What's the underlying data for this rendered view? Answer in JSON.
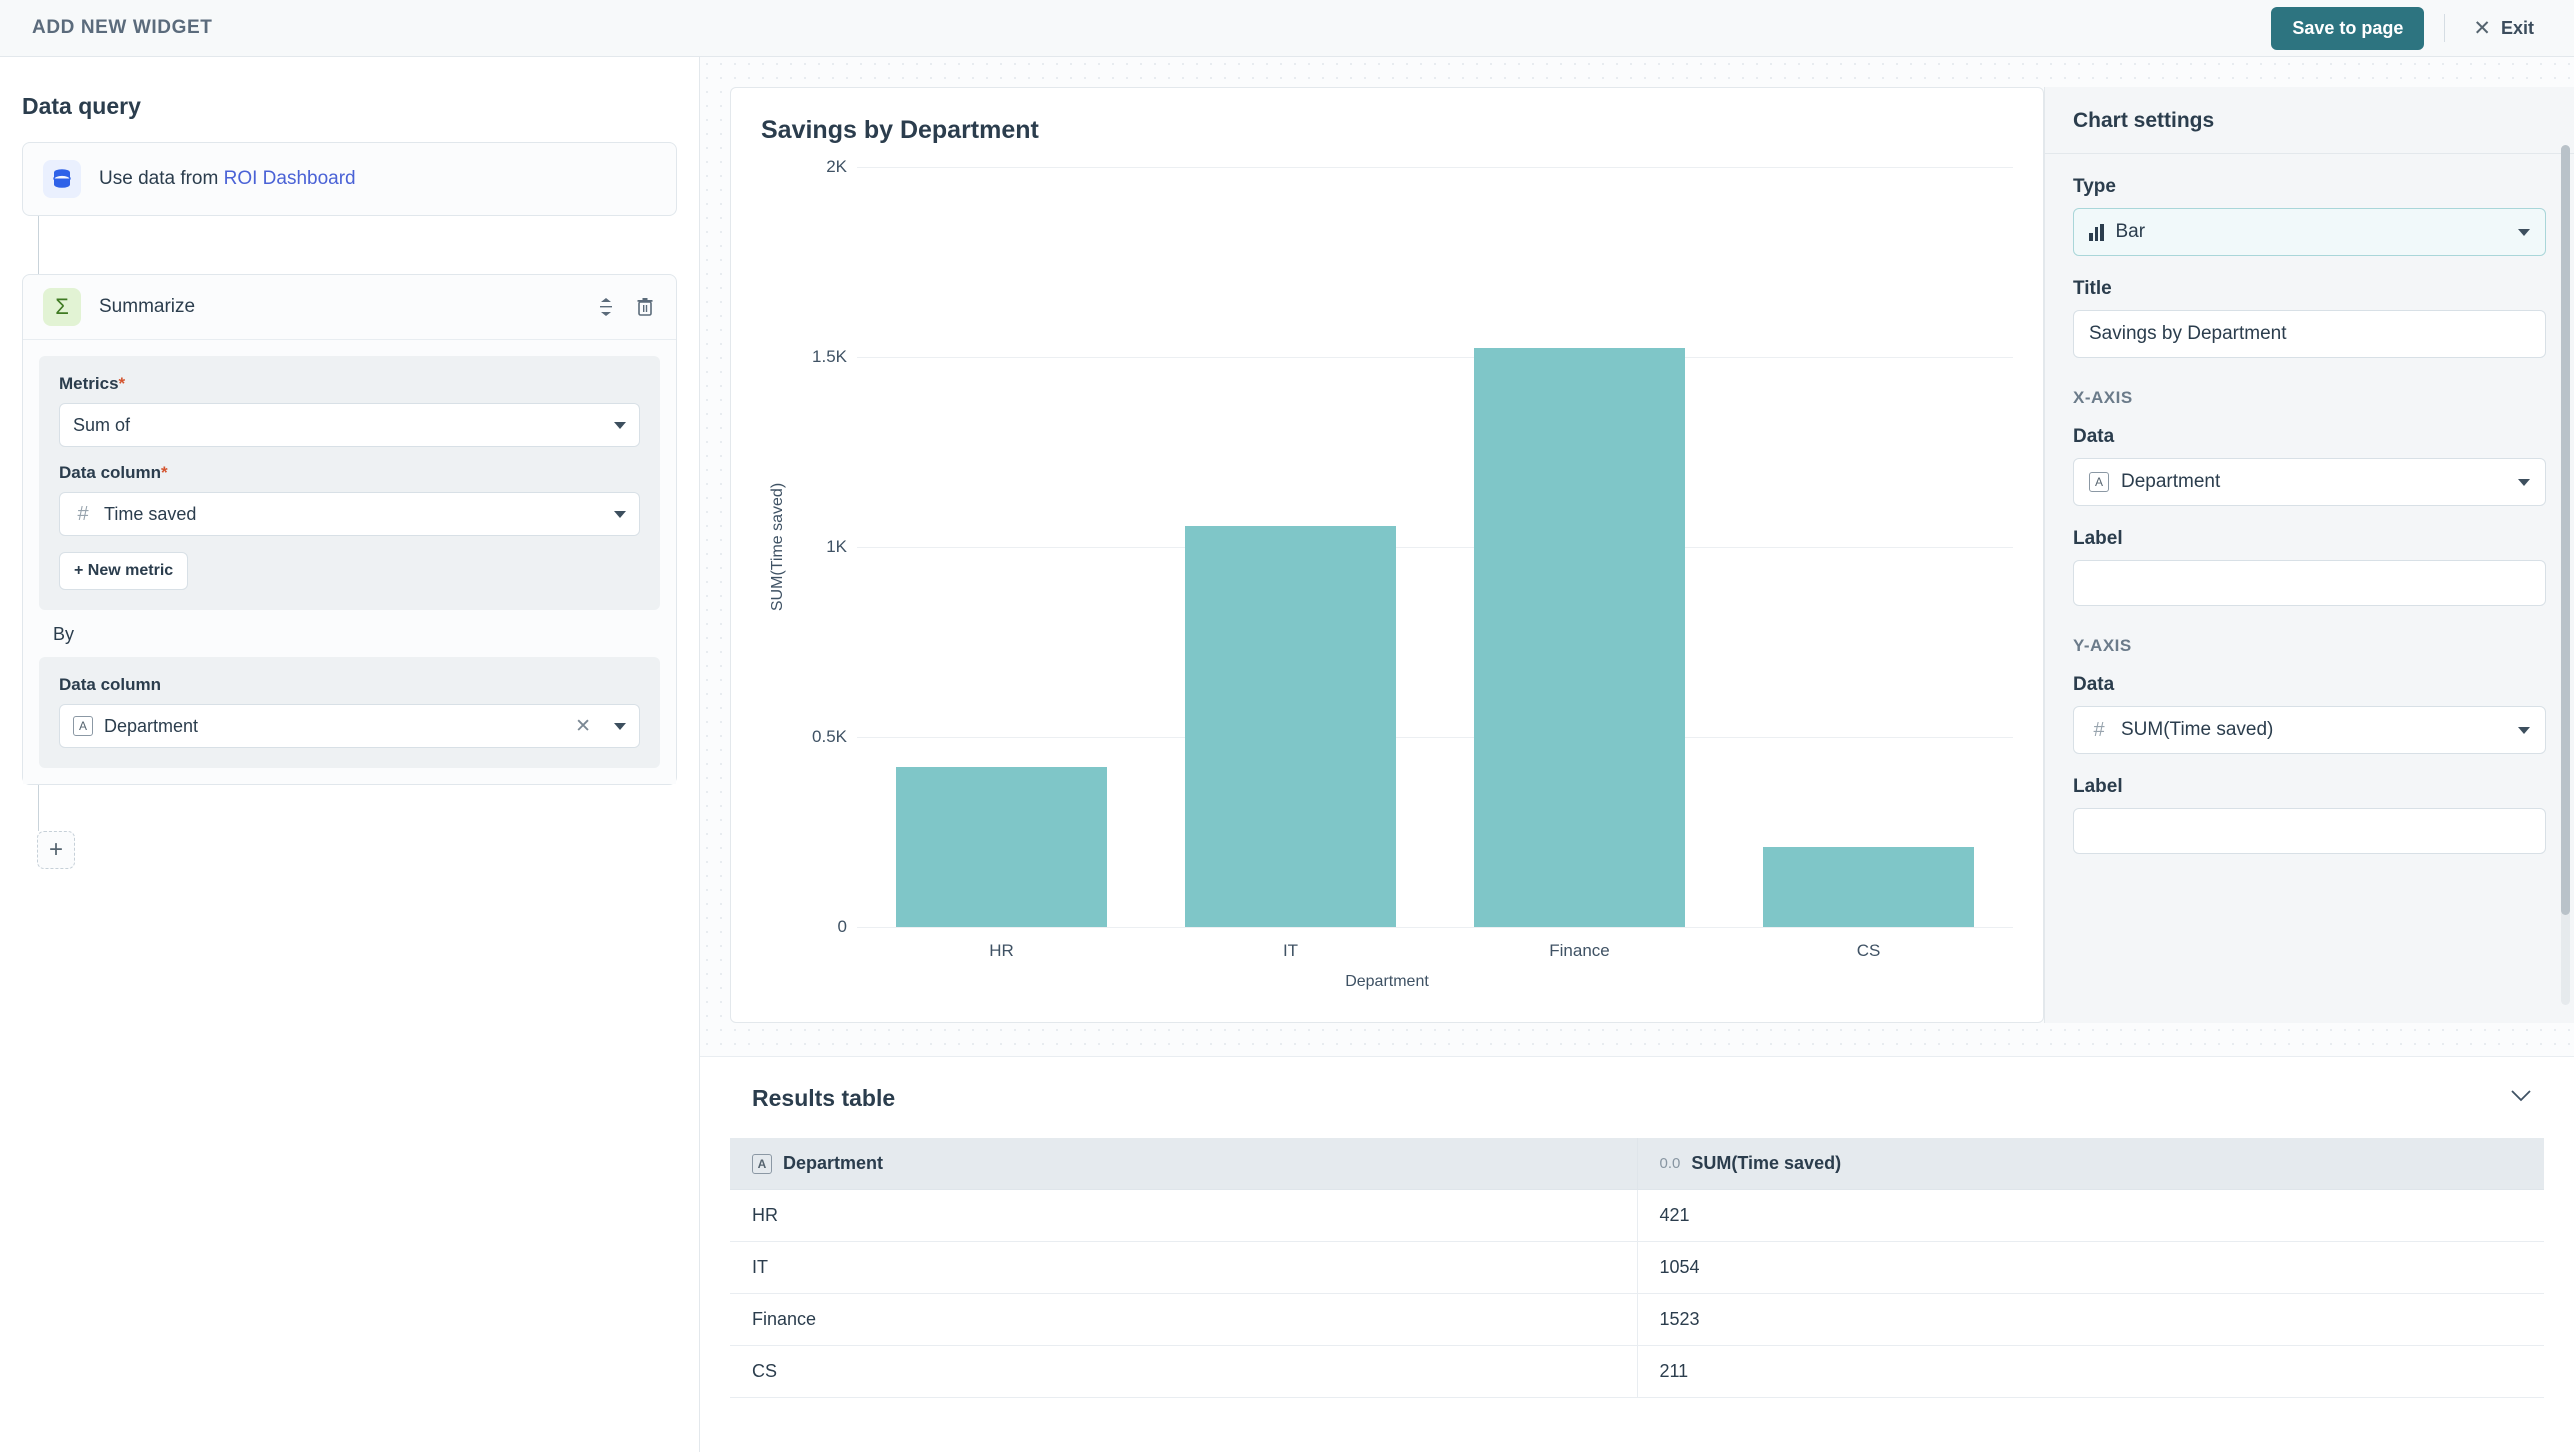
{
  "topbar": {
    "title": "ADD NEW WIDGET",
    "save_label": "Save to page",
    "exit_label": "Exit"
  },
  "left_panel": {
    "section_title": "Data query",
    "source": {
      "prefix": "Use data from ",
      "link": "ROI Dashboard",
      "icon": "database-icon"
    },
    "step": {
      "title": "Summarize",
      "icon": "sigma-icon",
      "metrics_label": "Metrics",
      "metrics_required": "*",
      "metrics_value": "Sum of",
      "data_column_label": "Data column",
      "data_column_required": "*",
      "data_column_value": "Time saved",
      "data_column_type": "number",
      "new_metric_label": "+ New metric",
      "by_label": "By",
      "by_data_column_label": "Data column",
      "by_data_column_value": "Department",
      "by_data_column_type": "A"
    },
    "add_step_label": "+"
  },
  "chart": {
    "card_title": "Savings by Department"
  },
  "chart_data": {
    "type": "bar",
    "title": "Savings by Department",
    "categories": [
      "HR",
      "IT",
      "Finance",
      "CS"
    ],
    "values": [
      421,
      1054,
      1523,
      211
    ],
    "xlabel": "Department",
    "ylabel": "SUM(Time saved)",
    "ylim": [
      0,
      2000
    ],
    "yticks": [
      0,
      500,
      1000,
      1500,
      2000
    ],
    "ytick_labels": [
      "0",
      "0.5K",
      "1K",
      "1.5K",
      "2K"
    ],
    "grid": true,
    "legend": null,
    "bar_color": "#7fc6c8"
  },
  "settings": {
    "header": "Chart settings",
    "type_label": "Type",
    "type_value": "Bar",
    "type_icon": "bar-chart-icon",
    "title_label": "Title",
    "title_value": "Savings by Department",
    "x_axis_group": "X-AXIS",
    "x_data_label": "Data",
    "x_data_value": "Department",
    "x_data_type": "A",
    "x_label_label": "Label",
    "x_label_value": "",
    "y_axis_group": "Y-AXIS",
    "y_data_label": "Data",
    "y_data_value": "SUM(Time saved)",
    "y_data_type": "number",
    "y_label_label": "Label",
    "y_label_value": ""
  },
  "results": {
    "title": "Results table",
    "columns": [
      {
        "label": "Department",
        "icon": "A"
      },
      {
        "label": "SUM(Time saved)",
        "icon": "0.0"
      }
    ],
    "rows": [
      {
        "department": "HR",
        "sum": "421"
      },
      {
        "department": "IT",
        "sum": "1054"
      },
      {
        "department": "Finance",
        "sum": "1523"
      },
      {
        "department": "CS",
        "sum": "211"
      }
    ]
  }
}
